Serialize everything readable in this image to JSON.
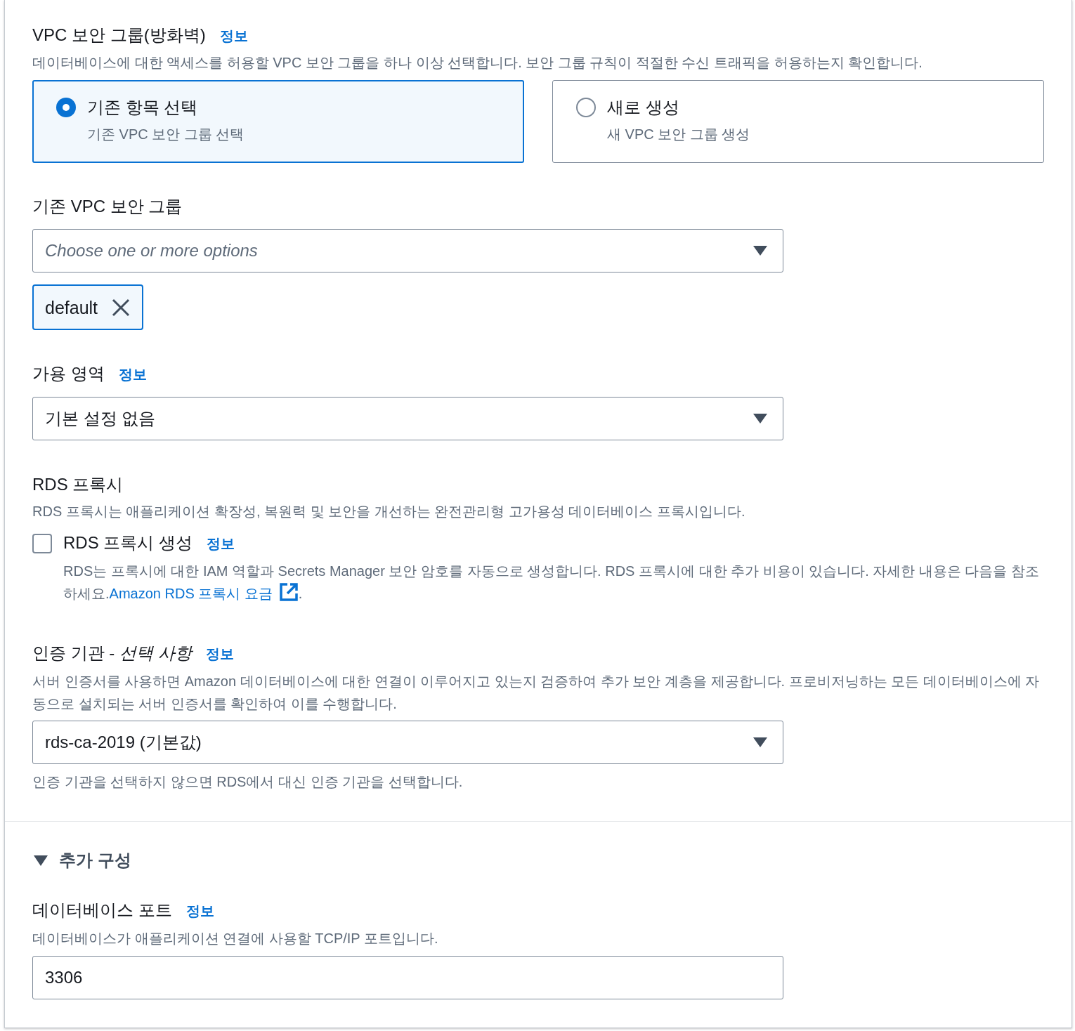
{
  "vpc_security_group": {
    "label": "VPC 보안 그룹(방화벽)",
    "info_link": "정보",
    "description": "데이터베이스에 대한 액세스를 허용할 VPC 보안 그룹을 하나 이상 선택합니다. 보안 그룹 규칙이 적절한 수신 트래픽을 허용하는지 확인합니다.",
    "options": [
      {
        "title": "기존 항목 선택",
        "description": "기존 VPC 보안 그룹 선택",
        "selected": true
      },
      {
        "title": "새로 생성",
        "description": "새 VPC 보안 그룹 생성",
        "selected": false
      }
    ]
  },
  "existing_vpc_security_groups": {
    "label": "기존 VPC 보안 그룹",
    "placeholder": "Choose one or more options",
    "tokens": [
      {
        "label": "default"
      }
    ]
  },
  "availability_zone": {
    "label": "가용 영역",
    "info_link": "정보",
    "value": "기본 설정 없음"
  },
  "rds_proxy": {
    "label": "RDS 프록시",
    "description": "RDS 프록시는 애플리케이션 확장성, 복원력 및 보안을 개선하는 완전관리형 고가용성 데이터베이스 프록시입니다.",
    "checkbox": {
      "label": "RDS 프록시 생성",
      "info_link": "정보",
      "checked": false,
      "description": "RDS는 프록시에 대한 IAM 역할과 Secrets Manager 보안 암호를 자동으로 생성합니다. RDS 프록시에 대한 추가 비용이 있습니다. 자세한 내용은 다음을 참조하세요.",
      "link": "Amazon RDS 프록시 요금",
      "after_link": "."
    }
  },
  "certificate_authority": {
    "label": "인증 기관 - *선택 사항*",
    "info_link": "정보",
    "description": "서버 인증서를 사용하면 Amazon 데이터베이스에 대한 연결이 이루어지고 있는지 검증하여 추가 보안 계층을 제공합니다. 프로비저닝하는 모든 데이터베이스에 자동으로 설치되는 서버 인증서를 확인하여 이를 수행합니다.",
    "value": "rds-ca-2019 (기본값)",
    "hint": "인증 기관을 선택하지 않으면 RDS에서 대신 인증 기관을 선택합니다."
  },
  "additional_configuration": {
    "title": "추가 구성",
    "expanded": true,
    "database_port": {
      "label": "데이터베이스 포트",
      "info_link": "정보",
      "description": "데이터베이스가 애플리케이션 연결에 사용할 TCP/IP 포트입니다.",
      "value": "3306"
    }
  }
}
